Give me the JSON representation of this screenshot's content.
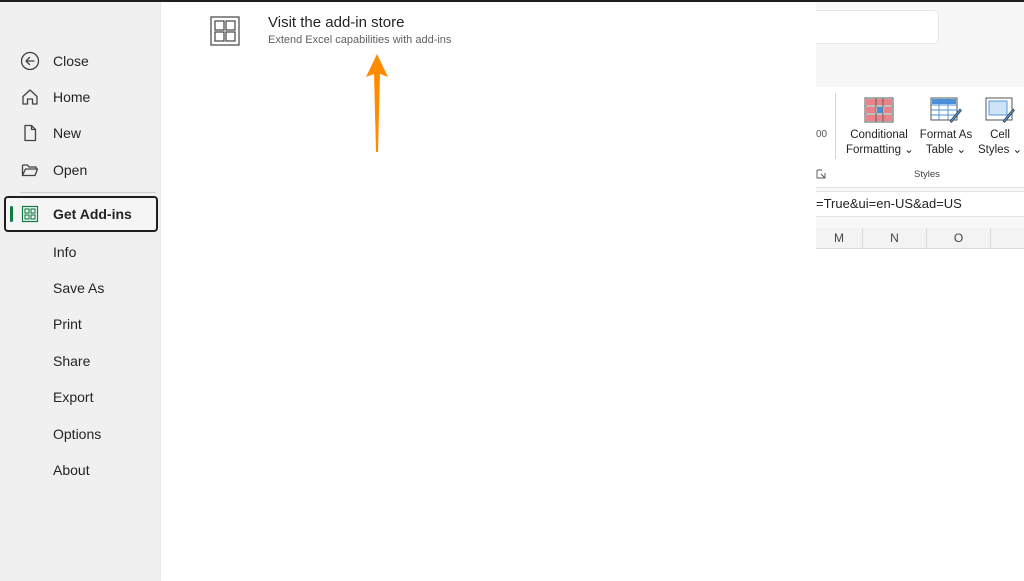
{
  "sidebar": {
    "items": [
      {
        "label": "Close",
        "icon": "back-arrow-circle-icon"
      },
      {
        "label": "Home",
        "icon": "home-icon"
      },
      {
        "label": "New",
        "icon": "new-document-icon"
      },
      {
        "label": "Open",
        "icon": "folder-open-icon"
      },
      {
        "label": "Get Add-ins",
        "icon": "add-ins-grid-icon",
        "active": true
      },
      {
        "label": "Info"
      },
      {
        "label": "Save As"
      },
      {
        "label": "Print"
      },
      {
        "label": "Share"
      },
      {
        "label": "Export"
      },
      {
        "label": "Options"
      },
      {
        "label": "About"
      }
    ]
  },
  "main": {
    "store": {
      "title": "Visit the add-in store",
      "description": "Extend Excel capabilities with add-ins",
      "icon": "store-grid-icon"
    },
    "annotation": {
      "icon": "orange-arrow-up-icon",
      "color": "#ff8c00"
    }
  },
  "excel": {
    "ribbon": {
      "conditional_formatting": {
        "line1": "Conditional",
        "line2": "Formatting"
      },
      "format_as_table": {
        "line1": "Format As",
        "line2": "Table"
      },
      "cell_styles": {
        "line1": "Cell",
        "line2": "Styles"
      },
      "group_label": "Styles",
      "chevron": "⌄"
    },
    "formula_bar": {
      "text": "=True&ui=en-US&ad=US"
    },
    "columns": [
      "M",
      "N",
      "O"
    ]
  },
  "colors": {
    "accent": "#107c41",
    "sidebar_bg": "#f0f0f0",
    "arrow": "#ff8c00"
  }
}
